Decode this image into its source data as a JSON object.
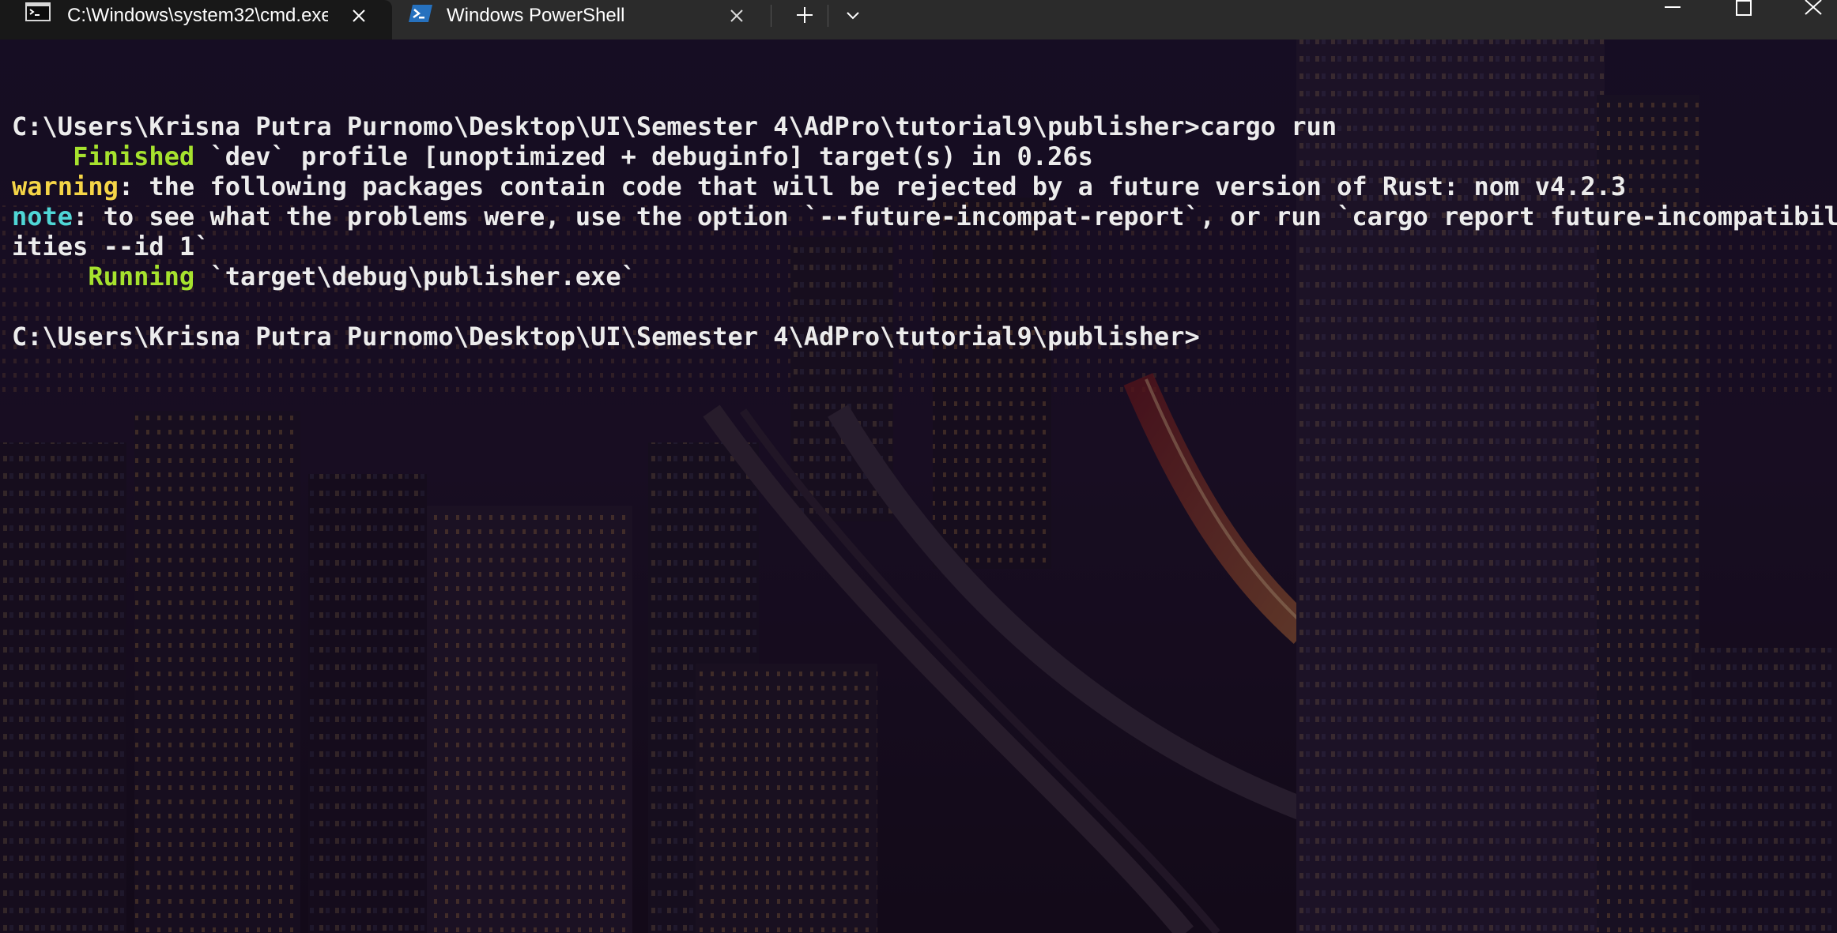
{
  "tabs": [
    {
      "title": "C:\\Windows\\system32\\cmd.exe",
      "icon": "cmd-icon",
      "active": true
    },
    {
      "title": "Windows PowerShell",
      "icon": "powershell-icon",
      "active": false
    }
  ],
  "titlebar": {
    "new_tab_icon": "plus-icon",
    "dropdown_icon": "chevron-down-icon",
    "window_controls": [
      "minimize-icon",
      "maximize-icon",
      "close-icon"
    ]
  },
  "terminal": {
    "lines": [
      {
        "segments": []
      },
      {
        "segments": [
          {
            "text": "C:\\Users\\Krisna Putra Purnomo\\Desktop\\UI\\Semester 4\\AdPro\\tutorial9\\publisher>cargo run",
            "style": "white"
          }
        ]
      },
      {
        "segments": [
          {
            "text": "    Finished",
            "style": "green"
          },
          {
            "text": " `dev` profile [unoptimized + debuginfo] target(s) in 0.26s",
            "style": "white"
          }
        ]
      },
      {
        "segments": [
          {
            "text": "warning",
            "style": "yellow"
          },
          {
            "text": ": the following packages contain code that will be rejected by a future version of Rust: nom v4.2.3",
            "style": "white"
          }
        ]
      },
      {
        "segments": [
          {
            "text": "note",
            "style": "cyan"
          },
          {
            "text": ": to see what the problems were, use the option `--future-incompat-report`, or run `cargo report future-incompatibil",
            "style": "white"
          }
        ]
      },
      {
        "segments": [
          {
            "text": "ities --id 1`",
            "style": "white"
          }
        ]
      },
      {
        "segments": [
          {
            "text": "     Running",
            "style": "green"
          },
          {
            "text": " `target\\debug\\publisher.exe`",
            "style": "white"
          }
        ]
      },
      {
        "segments": []
      },
      {
        "segments": [
          {
            "text": "C:\\Users\\Krisna Putra Purnomo\\Desktop\\UI\\Semester 4\\AdPro\\tutorial9\\publisher>",
            "style": "white"
          }
        ]
      }
    ]
  },
  "colors": {
    "titlebar_bg": "#2b2b2b",
    "active_tab_bg": "#181818",
    "finished_green": "#a6e22e",
    "warning_yellow": "#f5d547",
    "note_cyan": "#4fd6d6",
    "text": "#ececec"
  }
}
